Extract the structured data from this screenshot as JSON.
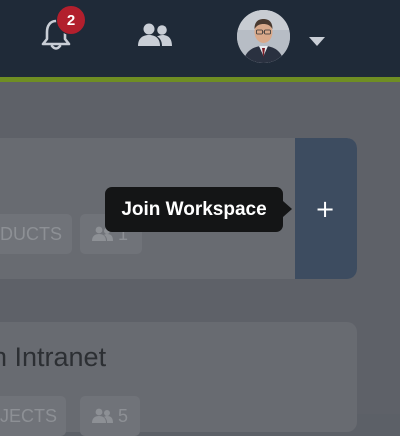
{
  "header": {
    "notifications": {
      "icon": "bell-icon",
      "badge_count": "2"
    },
    "people_icon": "users-icon",
    "user_menu": {
      "avatar": "user-avatar",
      "caret_icon": "chevron-down-icon"
    }
  },
  "colors": {
    "topbar": "#1f2a38",
    "accent_stripe": "#6f8e23",
    "badge": "#b21f2d",
    "action_panel": "#3d4c60",
    "tooltip": "#141516"
  },
  "workspace_card": {
    "products_chip": "DUCTS",
    "members_chip": "1",
    "add_icon": "+"
  },
  "second_card": {
    "title": "n Intranet",
    "projects_chip": "JECTS",
    "members_chip": "5"
  },
  "tooltip": {
    "text": "Join Workspace"
  }
}
